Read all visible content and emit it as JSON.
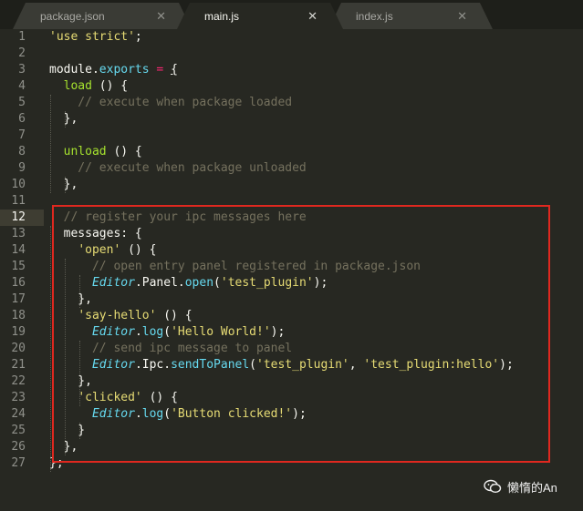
{
  "tabs": [
    {
      "label": "package.json",
      "close": "✕",
      "active": false
    },
    {
      "label": "main.js",
      "close": "✕",
      "active": true
    },
    {
      "label": "index.js",
      "close": "✕",
      "active": false
    }
  ],
  "line_numbers": [
    "1",
    "2",
    "3",
    "4",
    "5",
    "6",
    "7",
    "8",
    "9",
    "10",
    "11",
    "12",
    "13",
    "14",
    "15",
    "16",
    "17",
    "18",
    "19",
    "20",
    "21",
    "22",
    "23",
    "24",
    "25",
    "26",
    "27"
  ],
  "current_line": "12",
  "code": {
    "l1": "'use strict'",
    "l1_semi": ";",
    "l3_module": "module",
    "l3_dot": ".",
    "l3_exports": "exports",
    "l3_eq": " = ",
    "l3_brace": "{",
    "l4_indent": "  ",
    "l4_load": "load",
    "l4_rest": " () {",
    "l5_comment": "    // execute when package loaded",
    "l6": "  },",
    "l8_indent": "  ",
    "l8_unload": "unload",
    "l8_rest": " () {",
    "l9_comment": "    // execute when package unloaded",
    "l10": "  },",
    "l12_comment": "  // register your ipc messages here",
    "l13": "  messages: {",
    "l14_indent": "    ",
    "l14_key": "'open'",
    "l14_rest": " () {",
    "l15_comment": "      // open entry panel registered in package.json",
    "l16_indent": "      ",
    "l16_editor": "Editor",
    "l16_mid": ".Panel.",
    "l16_fn": "open",
    "l16_p1": "(",
    "l16_str": "'test_plugin'",
    "l16_p2": ");",
    "l17": "    },",
    "l18_indent": "    ",
    "l18_key": "'say-hello'",
    "l18_rest": " () {",
    "l19_indent": "      ",
    "l19_editor": "Editor",
    "l19_dot": ".",
    "l19_fn": "log",
    "l19_p1": "(",
    "l19_str": "'Hello World!'",
    "l19_p2": ");",
    "l20_comment": "      // send ipc message to panel",
    "l21_indent": "      ",
    "l21_editor": "Editor",
    "l21_mid": ".Ipc.",
    "l21_fn": "sendToPanel",
    "l21_p1": "(",
    "l21_str1": "'test_plugin'",
    "l21_comma": ", ",
    "l21_str2": "'test_plugin:hello'",
    "l21_p2": ");",
    "l22": "    },",
    "l23_indent": "    ",
    "l23_key": "'clicked'",
    "l23_rest": " () {",
    "l24_indent": "      ",
    "l24_editor": "Editor",
    "l24_dot": ".",
    "l24_fn": "log",
    "l24_p1": "(",
    "l24_str": "'Button clicked!'",
    "l24_p2": ");",
    "l25": "    }",
    "l26": "  },",
    "l27": "};"
  },
  "watermark": {
    "text": "懒惰的An",
    "icon": "wechat-icon"
  },
  "colors": {
    "background": "#272822",
    "string": "#e6db74",
    "comment": "#75715e",
    "keyword": "#66d9ef",
    "operator": "#f92672",
    "function": "#a6e22e",
    "highlight_box": "#e0281f"
  }
}
